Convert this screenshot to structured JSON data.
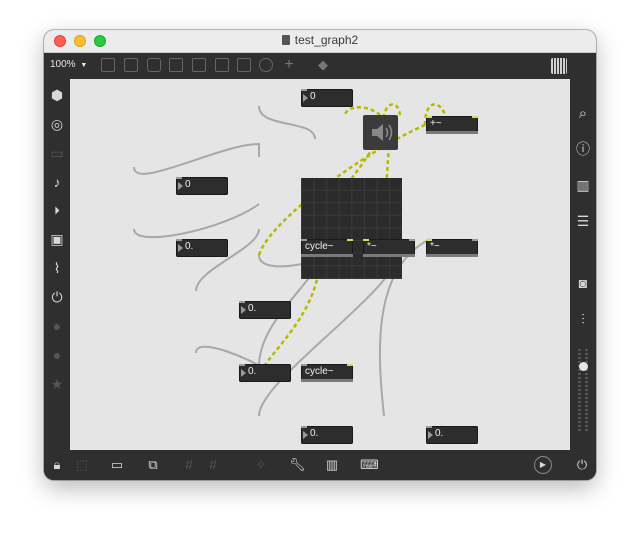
{
  "window": {
    "title": "test_graph2"
  },
  "toolbar": {
    "zoom_label": "100%",
    "zoom_caret": "▼"
  },
  "left_sidebar": {
    "items": [
      {
        "name": "cube-icon",
        "glyph": "⬢"
      },
      {
        "name": "target-icon",
        "glyph": "◎"
      },
      {
        "name": "film-icon",
        "glyph": "▭"
      },
      {
        "name": "music-note-icon",
        "glyph": "♪"
      },
      {
        "name": "step-icon",
        "glyph": "⏵"
      },
      {
        "name": "image-icon",
        "glyph": "▣"
      },
      {
        "name": "paperclip-icon",
        "glyph": "⌇"
      },
      {
        "name": "plug-icon",
        "glyph": "⏻"
      },
      {
        "name": "help-circle-icon",
        "glyph": "●"
      },
      {
        "name": "info-circle-icon",
        "glyph": "●"
      },
      {
        "name": "star-icon",
        "glyph": "★"
      }
    ]
  },
  "right_sidebar": {
    "items": [
      {
        "name": "search-icon",
        "glyph": "⌕"
      },
      {
        "name": "info-icon",
        "glyph": "ⓘ"
      },
      {
        "name": "book-icon",
        "glyph": "▥"
      },
      {
        "name": "list-icon",
        "glyph": "☰"
      },
      {
        "name": "camera-icon",
        "glyph": "◙"
      },
      {
        "name": "mixer-icon",
        "glyph": "⫶"
      }
    ]
  },
  "canvas": {
    "objects": [
      {
        "id": "num-top",
        "kind": "number",
        "value": "0"
      },
      {
        "id": "num-left1",
        "kind": "number",
        "value": "0"
      },
      {
        "id": "num-left2",
        "kind": "number",
        "value": "0."
      },
      {
        "id": "num-mid",
        "kind": "number",
        "value": "0."
      },
      {
        "id": "num-lower",
        "kind": "number",
        "value": "0."
      },
      {
        "id": "num-bottom1",
        "kind": "number",
        "value": "0."
      },
      {
        "id": "num-bottom2",
        "kind": "number",
        "value": "0."
      },
      {
        "id": "plus-sig",
        "kind": "object",
        "value": "+~"
      },
      {
        "id": "cycle1",
        "kind": "object",
        "value": "cycle~"
      },
      {
        "id": "mul1",
        "kind": "object",
        "value": "*~"
      },
      {
        "id": "mul2",
        "kind": "object",
        "value": "*~"
      },
      {
        "id": "cycle2",
        "kind": "object",
        "value": "cycle~"
      }
    ]
  },
  "bottom_bar": {
    "items": [
      {
        "name": "lock-icon",
        "glyph": "🔒︎"
      },
      {
        "name": "new-view-icon",
        "glyph": "⬚"
      },
      {
        "name": "presentation-icon",
        "glyph": "▭"
      },
      {
        "name": "windows-icon",
        "glyph": "⧉"
      },
      {
        "name": "grid-snap-icon",
        "glyph": "#"
      },
      {
        "name": "wand-icon",
        "glyph": "✧"
      },
      {
        "name": "wrench-icon",
        "glyph": "🔧︎"
      },
      {
        "name": "piano-icon",
        "glyph": "▥"
      },
      {
        "name": "keyboard-icon",
        "glyph": "⌨"
      },
      {
        "name": "play-icon",
        "glyph": "▶"
      },
      {
        "name": "power-icon",
        "glyph": "⏻"
      }
    ]
  }
}
